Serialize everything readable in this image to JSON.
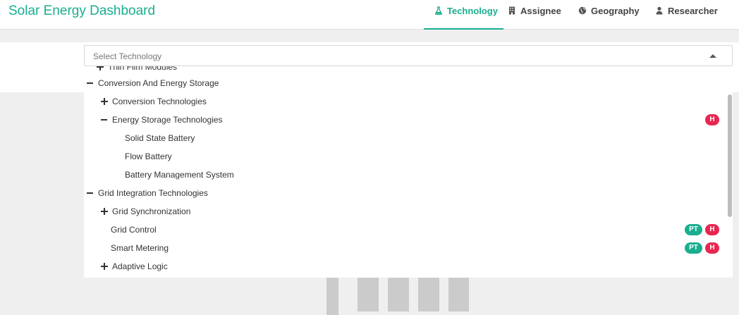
{
  "app": {
    "title": "Solar Energy Dashboard"
  },
  "nav": {
    "tabs": [
      {
        "label": "Technology",
        "icon": "flask-icon",
        "active": true
      },
      {
        "label": "Assignee",
        "icon": "building-icon",
        "active": false
      },
      {
        "label": "Geography",
        "icon": "globe-icon",
        "active": false
      },
      {
        "label": "Researcher",
        "icon": "user-icon",
        "active": false
      }
    ]
  },
  "select": {
    "placeholder": "Select Technology",
    "state": "open"
  },
  "tree": {
    "rows": [
      {
        "label": "Thin Film Modules",
        "toggle": "plus",
        "level": 1,
        "badges": []
      },
      {
        "label": "Conversion And Energy Storage",
        "toggle": "minus",
        "level": 0,
        "badges": []
      },
      {
        "label": "Conversion Technologies",
        "toggle": "plus",
        "level": 1,
        "badges": []
      },
      {
        "label": "Energy Storage Technologies",
        "toggle": "minus",
        "level": 1,
        "badges": [
          "H"
        ]
      },
      {
        "label": "Solid State Battery",
        "toggle": "none",
        "level": 2,
        "badges": []
      },
      {
        "label": "Flow Battery",
        "toggle": "none",
        "level": 2,
        "badges": []
      },
      {
        "label": "Battery Management System",
        "toggle": "none",
        "level": 2,
        "badges": []
      },
      {
        "label": "Grid Integration Technologies",
        "toggle": "minus",
        "level": 0,
        "badges": []
      },
      {
        "label": "Grid Synchronization",
        "toggle": "plus",
        "level": 1,
        "badges": []
      },
      {
        "label": "Grid Control",
        "toggle": "none",
        "level": 1,
        "badges": [
          "PT",
          "H"
        ]
      },
      {
        "label": "Smart Metering",
        "toggle": "none",
        "level": 1,
        "badges": [
          "PT",
          "H"
        ]
      },
      {
        "label": "Adaptive Logic",
        "toggle": "plus",
        "level": 1,
        "badges": []
      }
    ]
  },
  "colors": {
    "accent": "#1aae8f",
    "badge_pt": "#1aae8f",
    "badge_h": "#e8264f"
  }
}
